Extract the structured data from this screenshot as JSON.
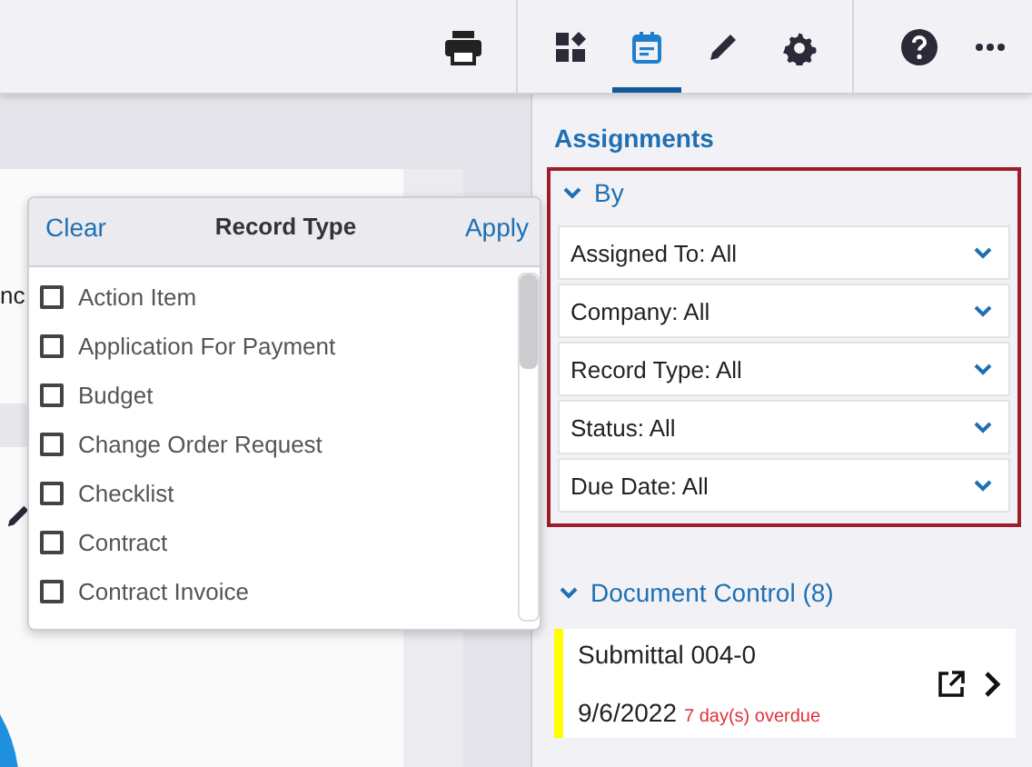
{
  "toolbar_tabs": [
    {
      "selected": false
    },
    {
      "selected": true
    },
    {
      "selected": false
    },
    {
      "selected": false
    }
  ],
  "background": {
    "clipped_text": "nc"
  },
  "record_type_popup": {
    "clear": "Clear",
    "title": "Record Type",
    "apply": "Apply",
    "options": [
      {
        "label": "Action Item",
        "checked": false
      },
      {
        "label": "Application For Payment",
        "checked": false
      },
      {
        "label": "Budget",
        "checked": false
      },
      {
        "label": "Change Order Request",
        "checked": false
      },
      {
        "label": "Checklist",
        "checked": false
      },
      {
        "label": "Contract",
        "checked": false
      },
      {
        "label": "Contract Invoice",
        "checked": false
      }
    ]
  },
  "assignments": {
    "title": "Assignments",
    "by_section": {
      "label": "By",
      "expanded": true,
      "filters": [
        "Assigned To: All",
        "Company: All",
        "Record Type: All",
        "Status: All",
        "Due Date: All"
      ]
    },
    "document_control": {
      "label": "Document Control (8)",
      "expanded": true,
      "items": [
        {
          "title": "Submittal 004-0",
          "date": "9/6/2022",
          "overdue": "7 day(s) overdue",
          "color": "#ffff00"
        }
      ]
    }
  }
}
